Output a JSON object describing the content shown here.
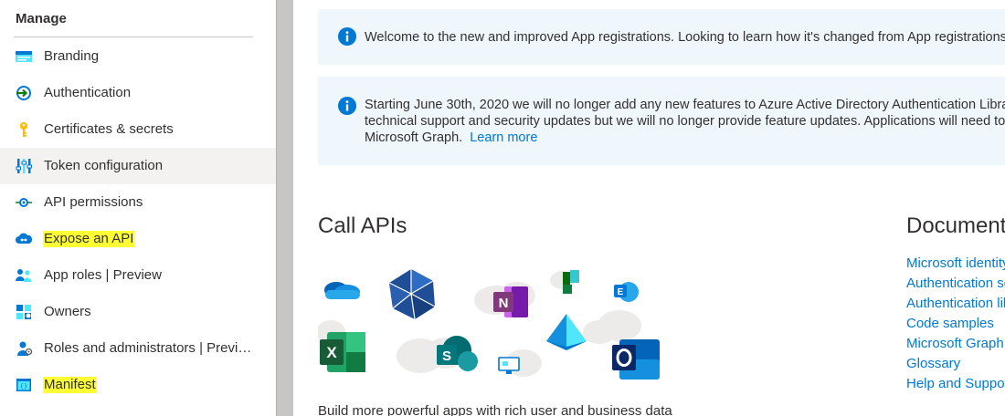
{
  "sidebar": {
    "heading": "Manage",
    "items": [
      {
        "label": "Branding",
        "icon": "branding-icon",
        "highlighted": false,
        "selected": false
      },
      {
        "label": "Authentication",
        "icon": "authentication-icon",
        "highlighted": false,
        "selected": false
      },
      {
        "label": "Certificates & secrets",
        "icon": "key-icon",
        "highlighted": false,
        "selected": false
      },
      {
        "label": "Token configuration",
        "icon": "token-configuration-icon",
        "highlighted": false,
        "selected": true
      },
      {
        "label": "API permissions",
        "icon": "api-permissions-icon",
        "highlighted": false,
        "selected": false
      },
      {
        "label": "Expose an API",
        "icon": "cloud-api-icon",
        "highlighted": true,
        "selected": false
      },
      {
        "label": "App roles | Preview",
        "icon": "app-roles-icon",
        "highlighted": false,
        "selected": false
      },
      {
        "label": "Owners",
        "icon": "owners-icon",
        "highlighted": false,
        "selected": false
      },
      {
        "label": "Roles and administrators | Preview",
        "icon": "roles-admin-icon",
        "highlighted": false,
        "selected": false
      },
      {
        "label": "Manifest",
        "icon": "manifest-icon",
        "highlighted": true,
        "selected": false
      }
    ]
  },
  "banners": {
    "welcome": {
      "icon": "info-icon",
      "text": "Welcome to the new and improved App registrations. Looking to learn how it's changed from App registrations (Legacy)?"
    },
    "deprecation": {
      "icon": "info-icon",
      "line1": "Starting June 30th, 2020 we will no longer add any new features to Azure Active Directory Authentication Library (ADAL) and",
      "line2": "technical support and security updates but we will no longer provide feature updates. Applications will need to be upgraded to",
      "line3": "Microsoft Graph.",
      "link": "Learn more"
    }
  },
  "call_apis": {
    "title": "Call APIs",
    "description": "Build more powerful apps with rich user and business data"
  },
  "documentation": {
    "title": "Documentation",
    "links": [
      "Microsoft identity platform",
      "Authentication scenarios",
      "Authentication libraries",
      "Code samples",
      "Microsoft Graph",
      "Glossary",
      "Help and Support"
    ]
  },
  "colors": {
    "accent": "#0078d4",
    "highlight": "#ffff33",
    "banner_bg": "#eff6fc",
    "selected_bg": "#f3f2f1"
  }
}
